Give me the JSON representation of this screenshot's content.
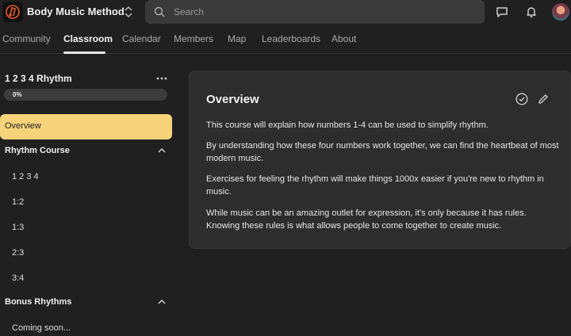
{
  "header": {
    "app_name": "Body Music Method",
    "search_placeholder": "Search"
  },
  "nav": {
    "tabs": [
      {
        "label": "Community"
      },
      {
        "label": "Classroom"
      },
      {
        "label": "Calendar"
      },
      {
        "label": "Members"
      },
      {
        "label": "Map"
      },
      {
        "label": "Leaderboards"
      },
      {
        "label": "About"
      }
    ],
    "active": "Classroom"
  },
  "sidebar": {
    "course_title": "1 2 3 4 Rhythm",
    "progress_text": "0%",
    "progress_value": 0,
    "overview_label": "Overview",
    "sections": [
      {
        "label": "Rhythm Course",
        "lessons": [
          "1 2 3 4",
          "1:2",
          "1:3",
          "2:3",
          "3:4"
        ]
      },
      {
        "label": "Bonus Rhythms",
        "lessons": [
          "Coming soon..."
        ]
      }
    ]
  },
  "main": {
    "title": "Overview",
    "paragraphs": [
      "This course will explain how numbers 1-4 can be used to simplify rhythm.",
      "By understanding how these four numbers work together, we can find the heartbeat of most modern music.",
      "Exercises for feeling the rhythm will make things 1000x easier if you're new to rhythm in music.",
      "While music can be an amazing outlet for expression, it's only because it has rules. Knowing these rules is what allows people to come together to create music."
    ]
  },
  "colors": {
    "accent": "#f6d37a",
    "background": "#202020",
    "card": "#2d2d2d"
  }
}
